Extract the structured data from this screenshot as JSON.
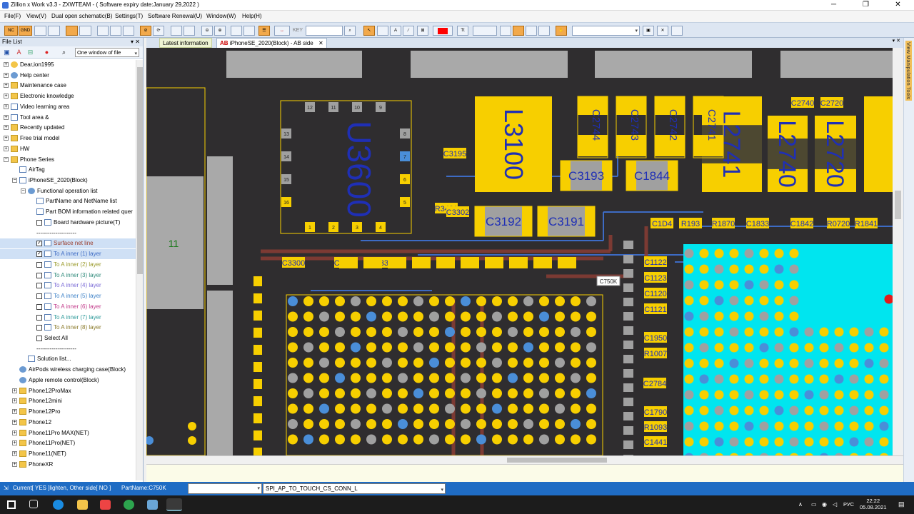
{
  "window": {
    "title": "Zillion x Work v3.3 - ZXWTEAM - ( Software expiry date:January 29,2022 )",
    "controls": [
      "─",
      "❐",
      "✕"
    ]
  },
  "menu": [
    "File(F)",
    "View(V)",
    "Dual open schematic(B)",
    "Settings(T)",
    "Software Renewal(U)",
    "Window(W)",
    "Help(H)"
  ],
  "toolbar": {
    "btn_nc": "NC",
    "btn_gnd": "GND",
    "key_label": "KEY",
    "font_label": "Tt",
    "highlight_color": "#ff0000"
  },
  "left_panel": {
    "title": "File List",
    "pin": "▾ ✕",
    "window_select": "One window of file",
    "items": [
      {
        "label": "Dear,ion1995",
        "depth": 0,
        "icon": "user-icon",
        "expand": "+"
      },
      {
        "label": "Help center",
        "depth": 0,
        "icon": "globe-icon",
        "expand": "+"
      },
      {
        "label": "Maintenance case",
        "depth": 0,
        "icon": "folder-icon",
        "expand": "+"
      },
      {
        "label": "Electronic knowledge",
        "depth": 0,
        "icon": "folder-icon",
        "expand": "+"
      },
      {
        "label": "Video learning area",
        "depth": 0,
        "icon": "document-icon",
        "expand": "+"
      },
      {
        "label": "Tool area &",
        "depth": 0,
        "icon": "document-icon",
        "expand": "+"
      },
      {
        "label": "Recently updated",
        "depth": 0,
        "icon": "folder-icon",
        "expand": "+"
      },
      {
        "label": "Free trial model",
        "depth": 0,
        "icon": "folder-icon",
        "expand": "+"
      },
      {
        "label": "HW",
        "depth": 0,
        "icon": "folder-icon",
        "expand": "+"
      },
      {
        "label": "Phone Series",
        "depth": 0,
        "icon": "folder-icon",
        "expand": "−"
      },
      {
        "label": "AirTag",
        "depth": 1,
        "icon": "document-icon",
        "expand": ""
      },
      {
        "label": "iPhoneSE_2020(Block)",
        "depth": 1,
        "icon": "document-icon",
        "expand": "−"
      },
      {
        "label": "Functional operation list",
        "depth": 2,
        "icon": "gear-icon",
        "expand": "−"
      },
      {
        "label": "PartName and NetName list",
        "depth": 3,
        "icon": "list-icon",
        "expand": ""
      },
      {
        "label": "Part BOM information related quer",
        "depth": 3,
        "icon": "list-icon",
        "expand": ""
      },
      {
        "label": "Board hardware picture(T)",
        "depth": 3,
        "icon": "picture-icon",
        "expand": "",
        "check": " "
      },
      {
        "label": "---------------------",
        "depth": 3,
        "icon": "",
        "expand": ""
      },
      {
        "label": "Surface net line",
        "depth": 3,
        "icon": "layer-icon",
        "expand": "",
        "check": "✓",
        "color": "#9a3e2e",
        "selected": true
      },
      {
        "label": "To A inner (1) layer",
        "depth": 3,
        "icon": "layer-icon",
        "expand": "",
        "check": "✓",
        "color": "#3d6bc4",
        "selected": true
      },
      {
        "label": "To A inner (2) layer",
        "depth": 3,
        "icon": "layer-icon",
        "expand": "",
        "check": " ",
        "color": "#9a9a2a"
      },
      {
        "label": "To A inner (3) layer",
        "depth": 3,
        "icon": "layer-icon",
        "expand": "",
        "check": " ",
        "color": "#2f8a7a"
      },
      {
        "label": "To A inner (4) layer",
        "depth": 3,
        "icon": "layer-icon",
        "expand": "",
        "check": " ",
        "color": "#7a6ad6"
      },
      {
        "label": "To A inner (5) layer",
        "depth": 3,
        "icon": "layer-icon",
        "expand": "",
        "check": " ",
        "color": "#3e82c8"
      },
      {
        "label": "To A inner (6) layer",
        "depth": 3,
        "icon": "layer-icon",
        "expand": "",
        "check": " ",
        "color": "#c23a8a"
      },
      {
        "label": "To A inner (7) layer",
        "depth": 3,
        "icon": "layer-icon",
        "expand": "",
        "check": " ",
        "color": "#2e9a9a"
      },
      {
        "label": "To A inner (8) layer",
        "depth": 3,
        "icon": "layer-icon",
        "expand": "",
        "check": " ",
        "color": "#8a7a2a"
      },
      {
        "label": "Select All",
        "depth": 3,
        "icon": "",
        "expand": "",
        "check": " "
      },
      {
        "label": "---------------------",
        "depth": 3,
        "icon": "",
        "expand": ""
      },
      {
        "label": "Solution list...",
        "depth": 2,
        "icon": "list-icon",
        "expand": ""
      },
      {
        "label": "AirPods wireless charging case(Block)",
        "depth": 1,
        "icon": "circle-icon",
        "expand": ""
      },
      {
        "label": "Apple remote control(Block)",
        "depth": 1,
        "icon": "circle-icon",
        "expand": ""
      },
      {
        "label": "Phone12ProMax",
        "depth": 1,
        "icon": "folder-icon",
        "expand": "+"
      },
      {
        "label": "Phone12mini",
        "depth": 1,
        "icon": "folder-icon",
        "expand": "+"
      },
      {
        "label": "Phone12Pro",
        "depth": 1,
        "icon": "folder-icon",
        "expand": "+"
      },
      {
        "label": " Phone12",
        "depth": 1,
        "icon": "folder-icon",
        "expand": "+"
      },
      {
        "label": "Phone11Pro MAX(NET)",
        "depth": 1,
        "icon": "folder-icon",
        "expand": "+"
      },
      {
        "label": "Phone11Pro(NET)",
        "depth": 1,
        "icon": "folder-icon",
        "expand": "+"
      },
      {
        "label": "Phone11(NET)",
        "depth": 1,
        "icon": "folder-icon",
        "expand": "+"
      },
      {
        "label": "PhoneXR",
        "depth": 1,
        "icon": "folder-icon",
        "expand": "+"
      }
    ]
  },
  "tabs": {
    "latest": "Latest information",
    "active": "iPhoneSE_2020(Block) - AB side",
    "active_prefix": "AB",
    "close": "✕",
    "dropdown": "▾ ✕"
  },
  "side_panel": {
    "label": "View Manipulation Tools"
  },
  "board": {
    "ic": {
      "name": "U3600",
      "pins_top": [
        "12",
        "11",
        "10",
        "9"
      ],
      "pins_left": [
        "13",
        "14",
        "15",
        "16"
      ],
      "pins_right": [
        "8",
        "7",
        "6",
        "5"
      ],
      "pins_bottom": [
        "1",
        "2",
        "3",
        "4"
      ]
    },
    "inductors": [
      "L3100",
      "L2741",
      "L2740",
      "L2720"
    ],
    "caps_vertical": [
      "C2744",
      "C2743",
      "C2742",
      "C2741"
    ],
    "caps_large": [
      "C3193",
      "C1844",
      "C3192",
      "C3191"
    ],
    "small_labels": [
      "C3195",
      "C2740",
      "C2720",
      "R3401",
      "C3302",
      "C1D4",
      "R193",
      "R1870",
      "C1833",
      "C1842",
      "R0720",
      "R1841",
      "C3300",
      "C3335",
      "C3334",
      "C1122",
      "C1123",
      "C1120",
      "C1121",
      "C1950",
      "R1007",
      "C1790",
      "R1093",
      "C1441",
      "C2784"
    ],
    "connector_label": "11",
    "tooltip": "C750K",
    "colors": {
      "board": "#2f2d2f",
      "pad": "#f7cf00",
      "gray_pad": "#a0a0a0",
      "blue_pad": "#4a8ed8",
      "trace_blue": "#3d6bc4",
      "trace_brown": "#8a3d34",
      "highlight": "#00e5ef",
      "label_blue": "#1f2fb5"
    }
  },
  "status": {
    "current": "Current[ YES ]lighten, Other side[ NO ]",
    "partname": "PartName:C750K",
    "combo_value": "",
    "signal": "SPI_AP_TO_TOUCH_CS_CONN_L"
  },
  "taskbar": {
    "lang": "РУС",
    "time": "22:22",
    "date": "05.08.2021"
  }
}
